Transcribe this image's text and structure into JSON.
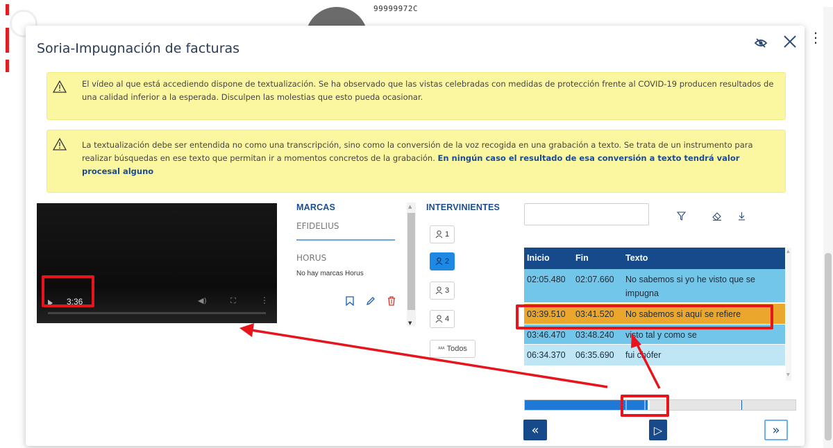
{
  "background": {
    "record_id": "99999972C"
  },
  "modal": {
    "title": "Soria-Impugnación de facturas",
    "hide_icon": "eye-slash-icon",
    "close_icon": "close-icon"
  },
  "notices": [
    {
      "icon": "warning-icon",
      "text": "El vídeo al que está accediendo dispone de textualización. Se ha observado que las vistas celebradas con medidas de protección frente al COVID-19 producen resultados de una calidad inferior a la esperada. Disculpen las molestias que esto pueda ocasionar.",
      "link_text": ""
    },
    {
      "icon": "warning-icon",
      "text": "La textualización debe ser entendida no como una transcripción, sino como la conversión de la voz recogida en una grabación a texto. Se trata de un instrumento para realizar búsquedas en ese texto que permitan ir a momentos concretos de la grabación. ",
      "link_text": "En ningún caso el resultado de esa conversión a texto tendrá valor procesal alguno"
    }
  ],
  "video": {
    "current_time": "3:36",
    "progress": 0
  },
  "marcas": {
    "title": "MARCAS",
    "tab_label": "EFIDELIUS",
    "horus_title": "HORUS",
    "horus_empty": "No hay marcas Horus",
    "actions": [
      "bookmark-icon",
      "pencil-icon",
      "trash-icon"
    ]
  },
  "intervinientes": {
    "title": "INTERVINIENTES",
    "items": [
      {
        "label": "1",
        "active": false
      },
      {
        "label": "2",
        "active": true
      },
      {
        "label": "3",
        "active": false
      },
      {
        "label": "4",
        "active": false
      }
    ],
    "all_label": "Todos"
  },
  "search": {
    "placeholder": "",
    "value": ""
  },
  "tools": [
    "filter-icon",
    "eraser-icon",
    "download-icon"
  ],
  "table": {
    "headers": [
      "Inicio",
      "Fin",
      "Texto"
    ],
    "rows": [
      {
        "start": "02:05.480",
        "end": "02:07.660",
        "text": "No sabemos si yo he visto que se impugna"
      },
      {
        "start": "03:39.510",
        "end": "03:41.520",
        "text": "No sabemos si aquí se refiere"
      },
      {
        "start": "03:46.470",
        "end": "03:48.240",
        "text": "visto tal y como se"
      },
      {
        "start": "06:34.370",
        "end": "06:35.690",
        "text": "fui chófer"
      }
    ]
  },
  "timeline": {
    "progress": 0.46
  },
  "nav": {
    "prev_label": "«",
    "play_label": "▷",
    "next_label": "»"
  },
  "colors": {
    "header_blue": "#174a8a",
    "row_blue": "#71c6e9",
    "row_selected": "#eba72b",
    "row_light": "#bfe6f5",
    "notice_yellow": "#fbf6a0",
    "annotation_red": "#e8141b"
  }
}
